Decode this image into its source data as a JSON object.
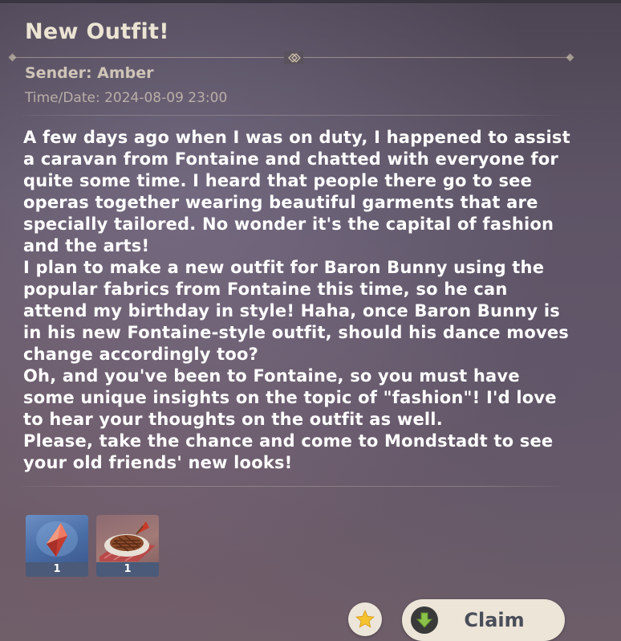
{
  "mail": {
    "title": "New Outfit!",
    "sender": "Sender: Amber",
    "datetime": "Time/Date: 2024-08-09 23:00",
    "paragraphs": [
      "A few days ago when I was on duty, I happened to assist a caravan from Fontaine and chatted with everyone for quite some time. I heard that people there go to see operas together wearing beautiful garments that are specially tailored. No wonder it's the capital of fashion and the arts!",
      "I plan to make a new outfit for Baron Bunny using the popular fabrics from Fontaine this time, so he can attend my birthday in style! Haha, once Baron Bunny is in his new Fontaine-style outfit, should his dance moves change accordingly too?",
      "Oh, and you've been to Fontaine, so you must have some unique insights on the topic of \"fashion\"! I'd love to hear your thoughts on the outfit as well.",
      "Please, take the chance and come to Mondstadt to see your old friends' new looks!"
    ]
  },
  "attachments": [
    {
      "icon": "red-crystal-icon",
      "count": "1"
    },
    {
      "icon": "grilled-steak-dish-icon",
      "count": "1"
    }
  ],
  "actions": {
    "favorite_icon": "star-icon",
    "claim_icon": "download-arrow-icon",
    "claim_label": "Claim"
  },
  "colors": {
    "title": "#ece4d3",
    "star": "#f5c230",
    "claim_icon_arrow": "#8bc34a",
    "count_bar": "#4a5a78"
  }
}
